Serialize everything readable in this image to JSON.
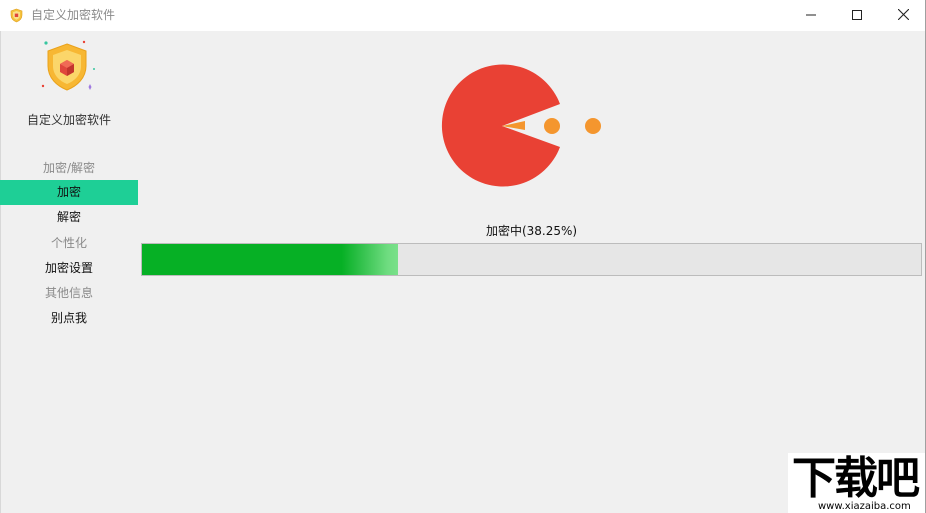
{
  "window": {
    "title": "自定义加密软件",
    "icon": "shield-app-icon",
    "controls": [
      "minimize-icon",
      "maximize-icon",
      "close-icon"
    ]
  },
  "sidebar": {
    "logo": "shield-logo-icon",
    "app_name": "自定义加密软件",
    "items": [
      {
        "label": "加密/解密",
        "kind": "section"
      },
      {
        "label": "加密",
        "kind": "link",
        "active": true
      },
      {
        "label": "解密",
        "kind": "link"
      },
      {
        "label": "个性化",
        "kind": "section"
      },
      {
        "label": "加密设置",
        "kind": "link"
      },
      {
        "label": "其他信息",
        "kind": "section"
      },
      {
        "label": "别点我",
        "kind": "link"
      }
    ]
  },
  "main": {
    "animation": "pacman-eating-dots",
    "progress": {
      "label": "加密中(38.25%)",
      "value": 0.3825
    }
  },
  "colors": {
    "accent": "#1ecf96",
    "progress_green": "#06b025",
    "pacman_red": "#e94134",
    "dot_orange": "#f4962e"
  },
  "watermark": {
    "main": "下载吧",
    "sub": "www.xiazaiba.com"
  }
}
